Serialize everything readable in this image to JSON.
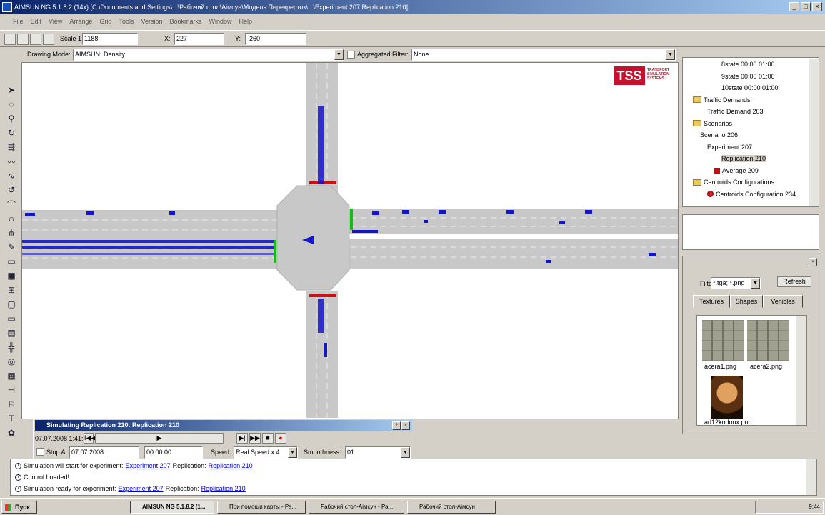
{
  "window": {
    "title": "AIMSUN NG 5.1.8.2 (14x) [C:\\Documents and Settings\\...\\Рабочий стол\\Аімсун\\Модель Перекресток\\...\\Experiment 207 Replication 210]"
  },
  "menu": [
    "File",
    "Edit",
    "View",
    "Arrange",
    "Grid",
    "Tools",
    "Version",
    "Bookmarks",
    "Window",
    "Help"
  ],
  "toolbar": {
    "scale_label": "Scale 1:",
    "scale_value": "1188",
    "x_label": "X:",
    "x_value": "227",
    "y_label": "Y:",
    "y_value": "-260"
  },
  "modebar": {
    "drawing_mode_label": "Drawing Mode:",
    "drawing_mode_value": "AIMSUN: Density",
    "aggregated_filter_label": "Aggregated Filter:",
    "aggregated_filter_value": "None"
  },
  "logo": {
    "mark": "TSS",
    "text": "TRANSPORT SIMULATION SYSTEMS"
  },
  "tree": [
    {
      "label": "8state 00:00 01:00",
      "indent": 5
    },
    {
      "label": "9state 00:00 01:00",
      "indent": 5
    },
    {
      "label": "10state 00:00 01:00",
      "indent": 5
    },
    {
      "label": "Traffic Demands",
      "indent": 1,
      "folder": true
    },
    {
      "label": "Traffic Demand 203",
      "indent": 3
    },
    {
      "label": "Scenarios",
      "indent": 1,
      "folder": true
    },
    {
      "label": "Scenario 206",
      "indent": 2
    },
    {
      "label": "Experiment 207",
      "indent": 3
    },
    {
      "label": "Replication 210",
      "indent": 5,
      "selected": true
    },
    {
      "label": "Average 209",
      "indent": 4,
      "rep": true
    },
    {
      "label": "Centroids Configurations",
      "indent": 1,
      "folder": true
    },
    {
      "label": "Centroids Configuration 234",
      "indent": 3,
      "cfg": true
    }
  ],
  "resources": {
    "filter_label": "Filter:",
    "filter_value": "*.tga; *.png",
    "refresh_label": "Refresh",
    "tabs": [
      "Textures",
      "Shapes",
      "Vehicles"
    ],
    "textures": [
      "acera1.png",
      "acera2.png",
      "ad12kodoux.png"
    ]
  },
  "sim_dialog": {
    "title": "Simulating Replication 210: Replication 210",
    "time": "07.07.2008 1:41:38",
    "rewind_label": "I◀◀",
    "play_label": "▶",
    "step_label": "▶|",
    "ffwd_label": "▶▶",
    "stop_label": "■",
    "rec_label": "●",
    "stop_at_label": "Stop At:",
    "stop_date": "07.07.2008",
    "stop_time": "00:00:00",
    "speed_label": "Speed:",
    "speed_value": "Real Speed x 4",
    "smoothness_label": "Smoothness:",
    "smoothness_value": "01"
  },
  "console": [
    {
      "pre": "Simulation will start for experiment:",
      "link1": "Experiment 207",
      "mid": "Replication:",
      "link2": "Replication 210"
    },
    {
      "pre": "Control Loaded!"
    },
    {
      "pre": "Simulation ready for experiment:",
      "link1": "Experiment 207",
      "mid": "Replication:",
      "link2": "Replication 210"
    }
  ],
  "taskbar": {
    "start": "Пуск",
    "tasks": [
      "AIMSUN NG 5.1.8.2 (1...",
      "При помощи карты - Ра...",
      "Рабочий стол-Аімсун - Ра...",
      "Рабочий стол-Аімсун"
    ],
    "clock": "9:44"
  },
  "colors": {
    "road": "#c8c8c8",
    "vehicle": "#1515c8",
    "signal_red": "#d01010",
    "signal_green": "#10c010",
    "title_blue": "#0a246a"
  }
}
